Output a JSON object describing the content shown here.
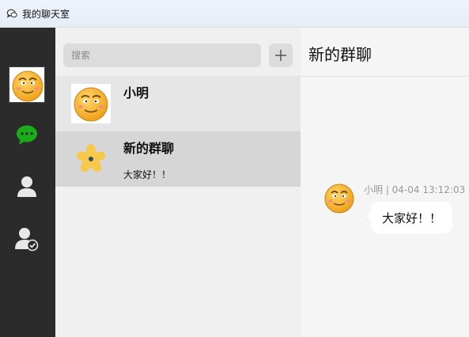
{
  "window": {
    "title": "我的聊天室"
  },
  "nav": {
    "items": [
      {
        "icon": "avatar"
      },
      {
        "icon": "chat-bubble-icon"
      },
      {
        "icon": "contact-person-icon"
      },
      {
        "icon": "friend-verified-icon"
      }
    ]
  },
  "search": {
    "placeholder": "搜索",
    "value": ""
  },
  "add_button": {
    "label": "+"
  },
  "sessions": [
    {
      "name": "小明",
      "last_message": ""
    },
    {
      "name": "新的群聊",
      "last_message": "大家好！！"
    }
  ],
  "chat": {
    "title": "新的群聊",
    "messages": [
      {
        "meta": "小明 | 04-04 13:12:03",
        "text": "大家好！！"
      }
    ]
  },
  "colors": {
    "nav_bg": "#2b2b2b",
    "chat_green": "#1aad19",
    "selected_session": "#d6d6d6"
  }
}
